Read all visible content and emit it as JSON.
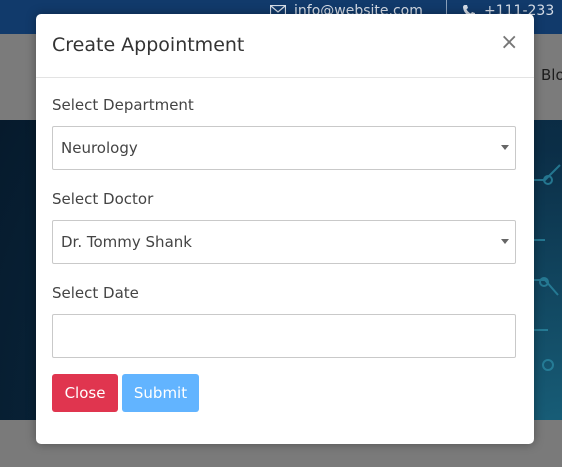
{
  "background": {
    "topbar": {
      "email": "info@website.com",
      "phone": "+111-233"
    },
    "nav_fragment": "Blo"
  },
  "modal": {
    "title": "Create Appointment",
    "close_icon": "×",
    "department": {
      "label": "Select Department",
      "value": "Neurology"
    },
    "doctor": {
      "label": "Select Doctor",
      "value": "Dr. Tommy Shank"
    },
    "date": {
      "label": "Select Date",
      "value": ""
    },
    "buttons": {
      "close": "Close",
      "submit": "Submit"
    }
  },
  "colors": {
    "close_button": "#e0354f",
    "submit_button": "#62b4ff",
    "topbar": "#113a6b",
    "overlay": "#7a7a7a"
  }
}
